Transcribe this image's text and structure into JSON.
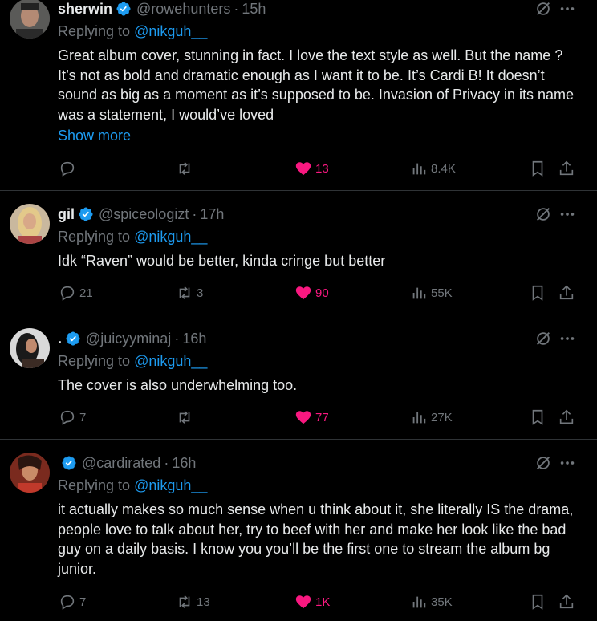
{
  "mention": "@nikguh__",
  "replying_prefix": "Replying to ",
  "replies": [
    {
      "name": "sherwin",
      "handle": "@rowehunters",
      "time": "15h",
      "text": "Great album cover, stunning in fact. I love the text style as well. But the name ? It’s not as bold and dramatic enough as I want it to be. It’s Cardi B! It doesn’t sound as big as a moment as it’s supposed to be. Invasion of Privacy in its name was a statement, I would’ve loved",
      "show_more": "Show more",
      "replies_count": "",
      "reposts": "",
      "likes": "13",
      "views": "8.4K"
    },
    {
      "name": "gil",
      "handle": "@spiceologizt",
      "time": "17h",
      "text": "Idk “Raven” would be better, kinda cringe but better",
      "replies_count": "21",
      "reposts": "3",
      "likes": "90",
      "views": "55K"
    },
    {
      "name": ".",
      "handle": "@juicyyminaj",
      "time": "16h",
      "text": "The cover is also underwhelming too.",
      "replies_count": "7",
      "reposts": "",
      "likes": "77",
      "views": "27K"
    },
    {
      "name": "",
      "handle": "@cardirated",
      "time": "16h",
      "text": "it actually makes so much sense when u think about it, she literally IS the drama, people love to talk about her, try to beef with her and make her look like the bad guy on a daily basis. I know you you’ll be the first one to stream the album bg junior.",
      "replies_count": "7",
      "reposts": "13",
      "likes": "1K",
      "views": "35K"
    }
  ],
  "colors": {
    "background": "#000000",
    "text": "#e7e9ea",
    "muted": "#71767b",
    "link": "#1d9bf0",
    "like": "#f91880",
    "verified": "#1d9bf0",
    "divider": "#2f3336"
  },
  "icons": [
    "verified-badge-icon",
    "grok-icon",
    "more-icon",
    "reply-icon",
    "repost-icon",
    "like-icon",
    "views-icon",
    "bookmark-icon",
    "share-icon"
  ]
}
